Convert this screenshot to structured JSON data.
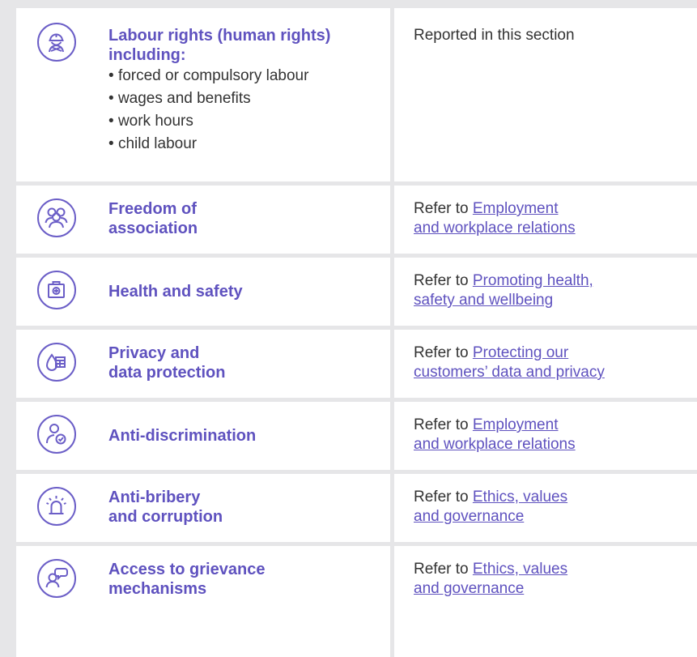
{
  "rows": [
    {
      "icon": "worker-helmet-icon",
      "topic_lines": [
        "Labour rights (human rights)",
        "including:"
      ],
      "bullets": [
        "forced or compulsory labour",
        "wages and benefits",
        "work hours",
        "child labour"
      ],
      "reference_plain": "Reported in this section"
    },
    {
      "icon": "group-people-icon",
      "topic_lines": [
        "Freedom of",
        "association"
      ],
      "reference_prefix": "Refer to ",
      "reference_link_lines": [
        "Employment",
        "and workplace relations"
      ]
    },
    {
      "icon": "first-aid-kit-icon",
      "topic_lines": [
        "Health and safety"
      ],
      "reference_prefix": "Refer to ",
      "reference_link_lines": [
        "Promoting health,",
        "safety and wellbeing"
      ]
    },
    {
      "icon": "data-protection-icon",
      "topic_lines": [
        "Privacy and",
        "data protection"
      ],
      "reference_prefix": "Refer to ",
      "reference_link_lines": [
        "Protecting our",
        "customers’ data and privacy"
      ]
    },
    {
      "icon": "person-check-icon",
      "topic_lines": [
        "Anti-discrimination"
      ],
      "reference_prefix": "Refer to ",
      "reference_link_lines": [
        "Employment",
        "and workplace relations"
      ]
    },
    {
      "icon": "alarm-siren-icon",
      "topic_lines": [
        "Anti-bribery",
        "and corruption"
      ],
      "reference_prefix": "Refer to ",
      "reference_link_lines": [
        "Ethics, values",
        "and governance"
      ]
    },
    {
      "icon": "person-speech-icon",
      "topic_lines": [
        "Access to grievance",
        "mechanisms"
      ],
      "reference_prefix": "Refer to ",
      "reference_link_lines": [
        "Ethics, values",
        "and governance"
      ]
    }
  ],
  "colors": {
    "accent": "#5f52bf",
    "text": "#333333",
    "background": "#e6e6e8",
    "cell": "#ffffff"
  }
}
